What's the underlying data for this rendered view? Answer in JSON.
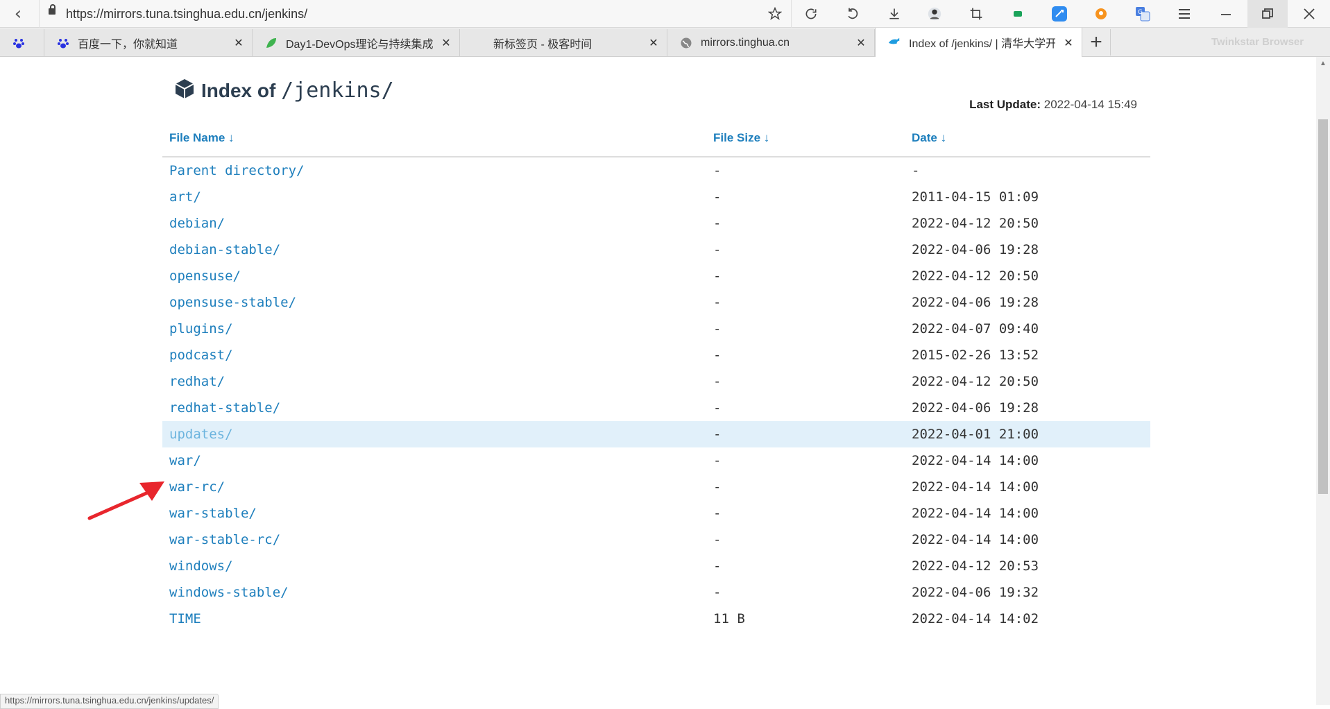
{
  "browser": {
    "url": "https://mirrors.tuna.tsinghua.edu.cn/jenkins/",
    "brand": "Twinkstar Browser",
    "new_tab_symbol": "+",
    "tabs": [
      {
        "label": "",
        "icon": "baidu-paw-icon"
      },
      {
        "label": "百度一下，你就知道",
        "icon": "baidu-paw-icon",
        "close": "✕"
      },
      {
        "label": "Day1-DevOps理论与持续集成",
        "icon": "leaf-icon",
        "close": "✕"
      },
      {
        "label": "新标签页 - 极客时间",
        "icon": "",
        "close": "✕"
      },
      {
        "label": "mirrors.tinghua.cn",
        "icon": "globe-icon",
        "close": "✕"
      },
      {
        "label": "Index of /jenkins/ | 清华大学开源软件镜像站",
        "icon": "tuna-fish-icon",
        "close": "✕",
        "active": true
      }
    ],
    "toolbar_icons": [
      "star-icon",
      "refresh-icon",
      "undo-icon",
      "download-icon",
      "avatar-icon",
      "crop-icon",
      "green-flag-icon",
      "blue-app-icon",
      "orange-app-icon",
      "translate-icon",
      "menu-icon",
      "minimize-icon",
      "restore-icon",
      "close-window-icon"
    ]
  },
  "page": {
    "heading_prefix": "Index of",
    "heading_path": "/jenkins/",
    "last_update_label": "Last Update:",
    "last_update_value": "2022-04-14 15:49",
    "columns": {
      "name": "File Name ↓",
      "size": "File Size ↓",
      "date": "Date ↓"
    },
    "rows": [
      {
        "name": "Parent directory/",
        "size": "-",
        "date": "-"
      },
      {
        "name": "art/",
        "size": "-",
        "date": "2011-04-15 01:09"
      },
      {
        "name": "debian/",
        "size": "-",
        "date": "2022-04-12 20:50"
      },
      {
        "name": "debian-stable/",
        "size": "-",
        "date": "2022-04-06 19:28"
      },
      {
        "name": "opensuse/",
        "size": "-",
        "date": "2022-04-12 20:50"
      },
      {
        "name": "opensuse-stable/",
        "size": "-",
        "date": "2022-04-06 19:28"
      },
      {
        "name": "plugins/",
        "size": "-",
        "date": "2022-04-07 09:40"
      },
      {
        "name": "podcast/",
        "size": "-",
        "date": "2015-02-26 13:52"
      },
      {
        "name": "redhat/",
        "size": "-",
        "date": "2022-04-12 20:50"
      },
      {
        "name": "redhat-stable/",
        "size": "-",
        "date": "2022-04-06 19:28"
      },
      {
        "name": "updates/",
        "size": "-",
        "date": "2022-04-01 21:00",
        "highlighted": true
      },
      {
        "name": "war/",
        "size": "-",
        "date": "2022-04-14 14:00"
      },
      {
        "name": "war-rc/",
        "size": "-",
        "date": "2022-04-14 14:00"
      },
      {
        "name": "war-stable/",
        "size": "-",
        "date": "2022-04-14 14:00"
      },
      {
        "name": "war-stable-rc/",
        "size": "-",
        "date": "2022-04-14 14:00"
      },
      {
        "name": "windows/",
        "size": "-",
        "date": "2022-04-12 20:53"
      },
      {
        "name": "windows-stable/",
        "size": "-",
        "date": "2022-04-06 19:32"
      },
      {
        "name": "TIME",
        "size": "11 B",
        "date": "2022-04-14 14:02"
      }
    ],
    "status_url": "https://mirrors.tuna.tsinghua.edu.cn/jenkins/updates/"
  },
  "colors": {
    "link": "#1e7fbd",
    "highlight_row": "#e1f0fa",
    "annotation_arrow": "#e8262d"
  }
}
